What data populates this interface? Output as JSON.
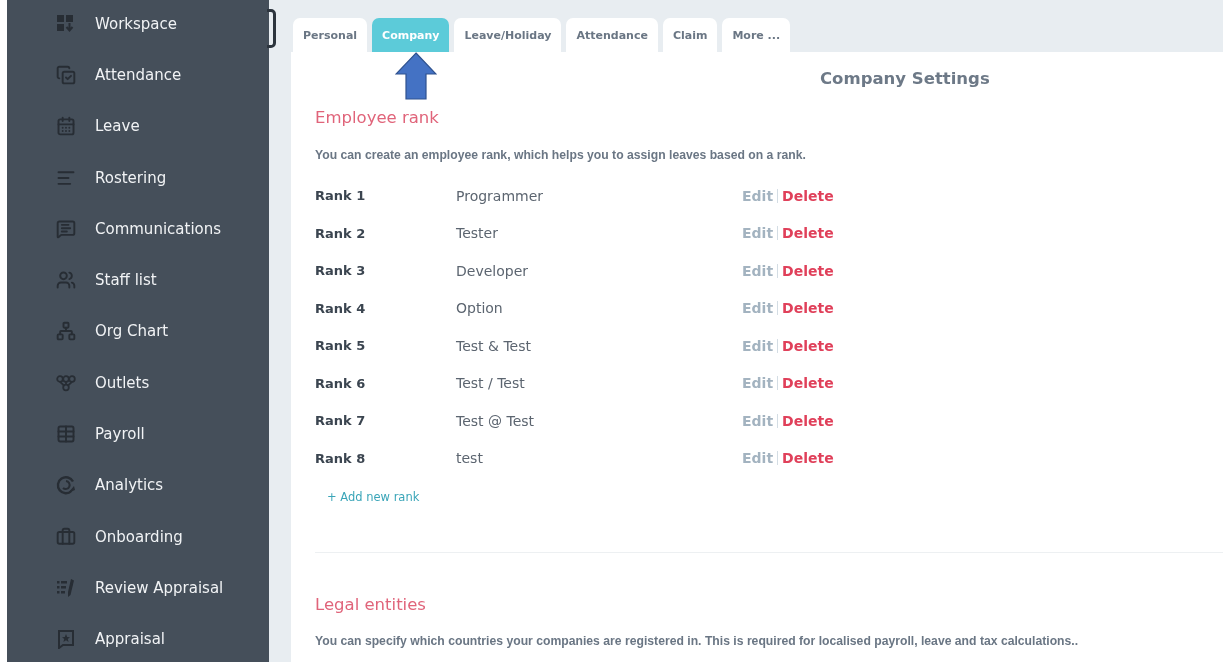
{
  "sidebar": {
    "items": [
      {
        "label": "Workspace"
      },
      {
        "label": "Attendance"
      },
      {
        "label": "Leave"
      },
      {
        "label": "Rostering"
      },
      {
        "label": "Communications"
      },
      {
        "label": "Staff list"
      },
      {
        "label": "Org Chart"
      },
      {
        "label": "Outlets"
      },
      {
        "label": "Payroll"
      },
      {
        "label": "Analytics"
      },
      {
        "label": "Onboarding"
      },
      {
        "label": "Review Appraisal"
      },
      {
        "label": "Appraisal"
      }
    ]
  },
  "tabs": [
    {
      "label": "Personal",
      "selected": false
    },
    {
      "label": "Company",
      "selected": true
    },
    {
      "label": "Leave/Holiday",
      "selected": false
    },
    {
      "label": "Attendance",
      "selected": false
    },
    {
      "label": "Claim",
      "selected": false
    },
    {
      "label": "More ...",
      "selected": false
    }
  ],
  "page_title": "Company Settings",
  "employee_rank": {
    "heading": "Employee rank",
    "description": "You can create an employee rank, which helps you to assign leaves based on a rank.",
    "ranks": [
      {
        "rank": "Rank 1",
        "title": "Programmer",
        "edit": "Edit",
        "delete": "Delete"
      },
      {
        "rank": "Rank 2",
        "title": "Tester",
        "edit": "Edit",
        "delete": "Delete"
      },
      {
        "rank": "Rank 3",
        "title": "Developer",
        "edit": "Edit",
        "delete": "Delete"
      },
      {
        "rank": "Rank 4",
        "title": "Option",
        "edit": "Edit",
        "delete": "Delete"
      },
      {
        "rank": "Rank 5",
        "title": "Test & Test",
        "edit": "Edit",
        "delete": "Delete"
      },
      {
        "rank": "Rank 6",
        "title": "Test / Test",
        "edit": "Edit",
        "delete": "Delete"
      },
      {
        "rank": "Rank 7",
        "title": "Test @ Test",
        "edit": "Edit",
        "delete": "Delete"
      },
      {
        "rank": "Rank 8",
        "title": "test",
        "edit": "Edit",
        "delete": "Delete"
      }
    ],
    "add_link": "+ Add new rank"
  },
  "legal_entities": {
    "heading": "Legal entities",
    "description": "You can specify which countries your companies are registered in. This is required for localised payroll, leave and tax calculations.."
  }
}
